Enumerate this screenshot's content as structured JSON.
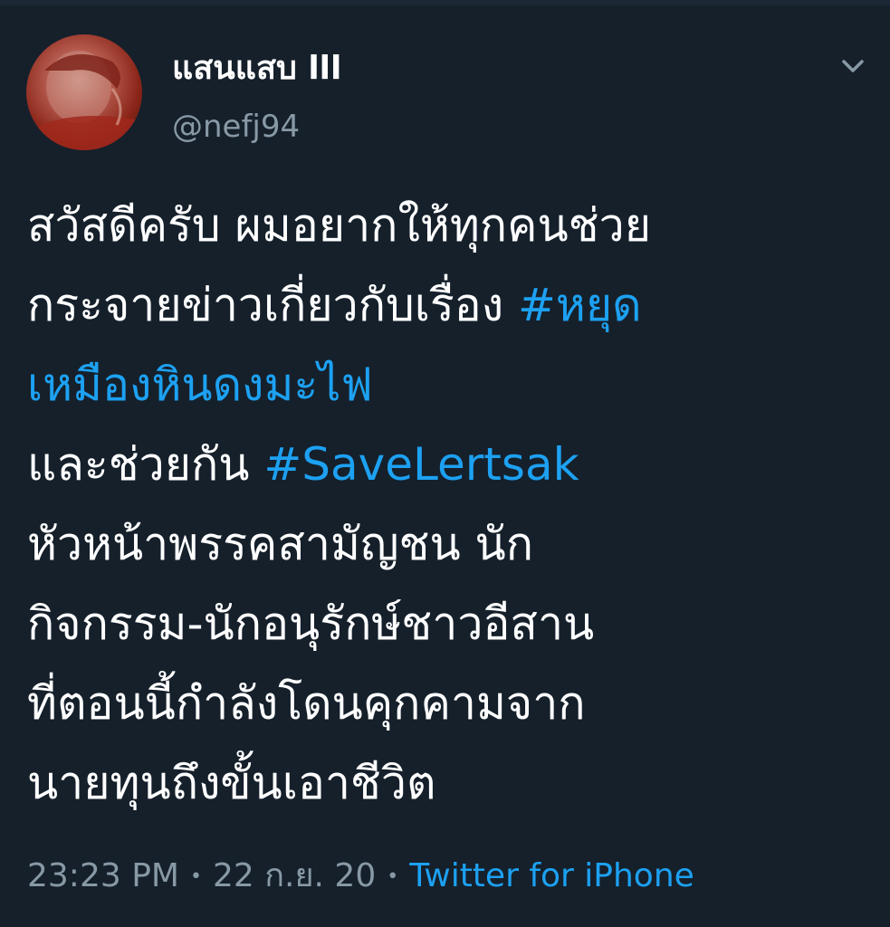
{
  "theme": {
    "background": "#15202b",
    "text": "#ffffff",
    "muted": "#8899a6",
    "link": "#1da1f2"
  },
  "tweet": {
    "author": {
      "display_name": "แสนแสบ lll",
      "handle": "@nefj94",
      "avatar_icon": "profile-photo"
    },
    "menu_icon": "chevron-down-icon",
    "text": {
      "line1": "สวัสดีครับ ผมอยากให้ทุกคนช่วย",
      "line2_text": "กระจายข่าวเกี่ยวกับเรื่อง ",
      "line2_hashtag": "#หยุด",
      "line3_hashtag": "เหมืองหินดงมะไฟ",
      "line4_text": "และช่วยกัน ",
      "line4_hashtag": "#SaveLertsak",
      "line5": "หัวหน้าพรรคสามัญชน นัก",
      "line6": "กิจกรรม-นักอนุรักษ์ชาวอีสาน",
      "line7": "ที่ตอนนี้กำลังโดนคุกคามจาก",
      "line8": "นายทุนถึงขั้นเอาชีวิต"
    },
    "meta": {
      "time": "23:23 PM",
      "separator": "•",
      "date": "22 ก.ย. 20",
      "source": "Twitter for iPhone"
    }
  }
}
